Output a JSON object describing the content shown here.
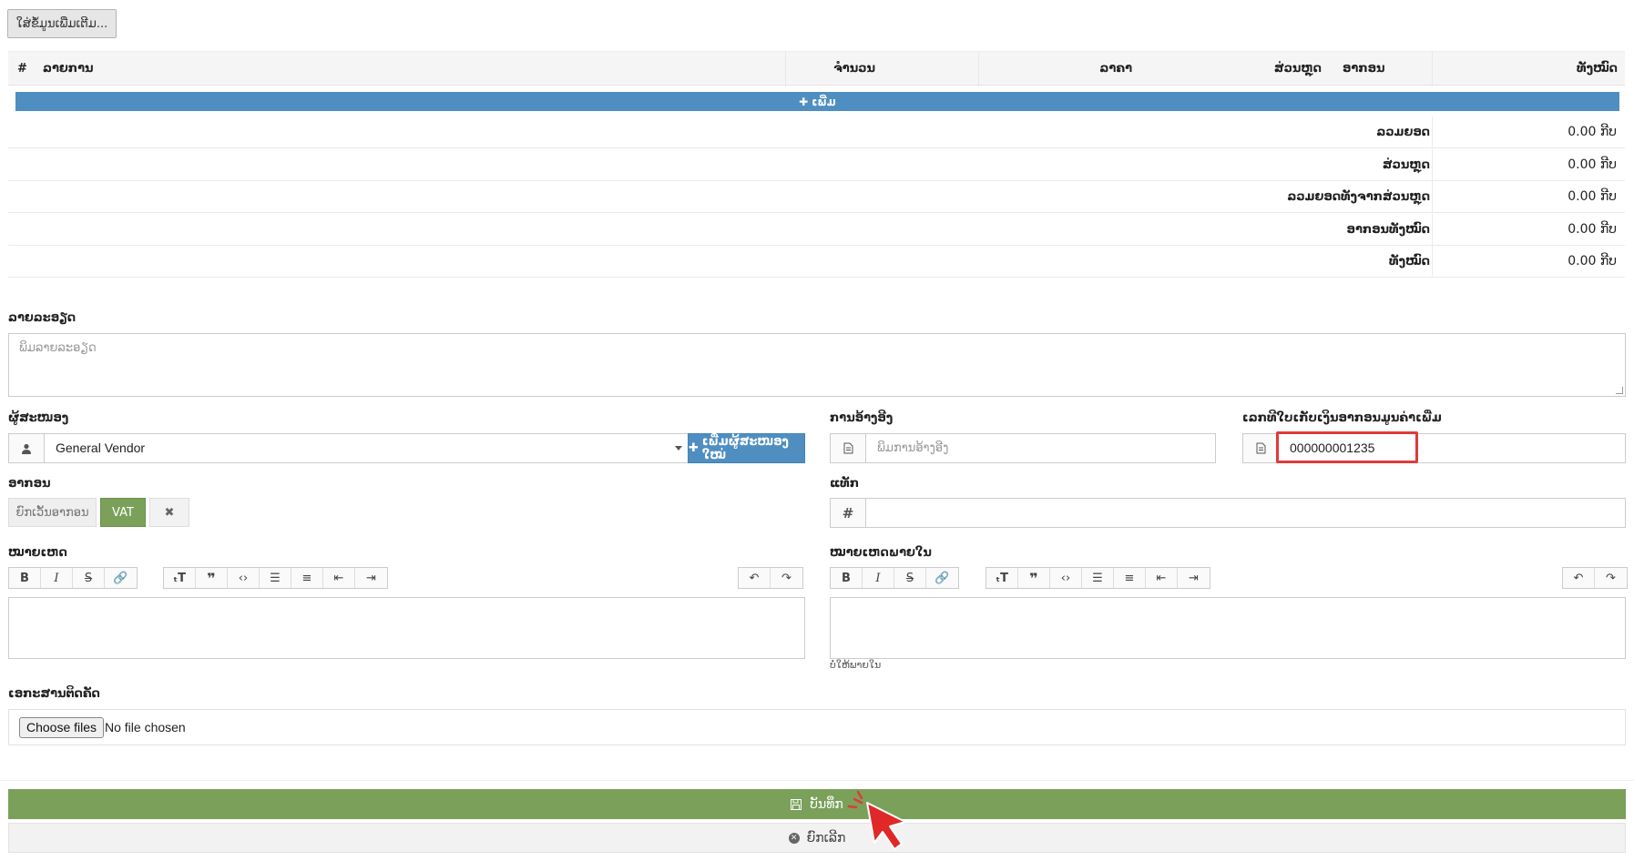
{
  "top": {
    "more_button": "ໃສ່ຂໍ້ມູນເພີ່ມເຕີມ..."
  },
  "items_table": {
    "headers": [
      "#",
      "ລາຍການ",
      "ຈຳນວນ",
      "ລາຄາ",
      "ສ່ວນຫຼຸດ",
      "ອາກອນ",
      "ທັງໝົດ"
    ],
    "add_label": "ເພີ່ມ"
  },
  "totals": [
    {
      "label": "ລວມຍອດ",
      "value": "0.00 ກີບ"
    },
    {
      "label": "ສ່ວນຫຼຸດ",
      "value": "0.00 ກີບ"
    },
    {
      "label": "ລວມຍອດທັງຈາກສ່ວນຫຼຸດ",
      "value": "0.00 ກີບ"
    },
    {
      "label": "ອາກອນທັງໝົດ",
      "value": "0.00 ກີບ"
    },
    {
      "label": "ທັງໝົດ",
      "value": "0.00 ກີບ"
    }
  ],
  "description": {
    "label": "ລາຍລະອຽດ",
    "placeholder": "ພິມລາຍລະອຽດ"
  },
  "vendor": {
    "label": "ຜູ້ສະໜອງ",
    "value": "General Vendor",
    "add_button": "ເພີ່ມຜູ້ສະໜອງໃໝ່"
  },
  "reference": {
    "label": "ການອ້າງອີງ",
    "placeholder": "ພິມການອ້າງອີງ"
  },
  "vat_invoice": {
    "label": "ເລກທີໃບເກັບເງິນອາກອນມູນຄ່າເພີ່ມ",
    "value": "000000001235"
  },
  "tax": {
    "label": "ອາກອນ",
    "exempt_button": "ຍົກເວັ້ນອາກອນ",
    "vat_button": "VAT",
    "clear_button": "✖"
  },
  "tags": {
    "label": "ແທັກ"
  },
  "notes": {
    "label": "ໝາຍເຫດ"
  },
  "footer_notes": {
    "label": "ໝາຍເຫດພາຍໃນ",
    "hint": "ບໍ່ໃຫ້ພາຍໃນ"
  },
  "attachments": {
    "label": "ເອກະສານຕິດຄັດ",
    "choose_button": "Choose files",
    "status": "No file chosen"
  },
  "actions": {
    "save": "ບັນທຶກ",
    "cancel": "ຍົກເລີກ"
  },
  "colors": {
    "primary_blue": "#4f8ec1",
    "save_green": "#7aa05a",
    "highlight_red": "#e03a3a"
  }
}
